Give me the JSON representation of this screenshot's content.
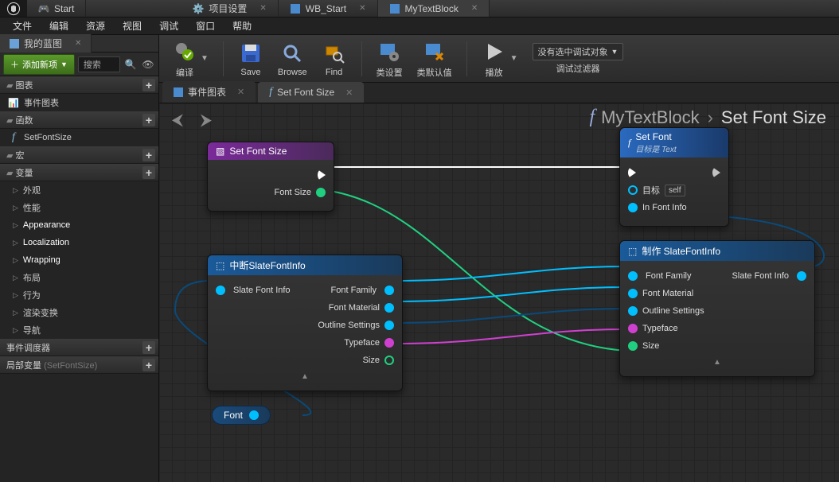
{
  "topTabs": [
    "Start",
    "项目设置",
    "WB_Start",
    "MyTextBlock"
  ],
  "menu": [
    "文件",
    "编辑",
    "资源",
    "视图",
    "调试",
    "窗口",
    "帮助"
  ],
  "bpTab": "我的蓝图",
  "addBtn": "添加新项",
  "searchPlaceholder": "搜索",
  "sections": {
    "charts": {
      "label": "图表",
      "items": [
        "事件图表"
      ]
    },
    "funcs": {
      "label": "函数",
      "items": [
        "SetFontSize"
      ]
    },
    "macros": {
      "label": "宏"
    },
    "vars": {
      "label": "变量",
      "items": [
        "外观",
        "性能",
        "Appearance",
        "Localization",
        "Wrapping",
        "布局",
        "行为",
        "渲染变换",
        "导航"
      ],
      "bold": [
        2,
        3,
        4
      ]
    },
    "disp": {
      "label": "事件调度器"
    },
    "local": {
      "label": "局部变量",
      "dim": "(SetFontSize)"
    }
  },
  "toolbar": {
    "compile": "编译",
    "save": "Save",
    "browse": "Browse",
    "find": "Find",
    "classSet": "类设置",
    "classDef": "类默认值",
    "play": "播放",
    "debugSel": "没有选中调试对象",
    "debugFilter": "调试过滤器"
  },
  "gtabs": [
    "事件图表",
    "Set Font Size"
  ],
  "bread": [
    "MyTextBlock",
    "Set Font Size"
  ],
  "nodes": {
    "entry": {
      "title": "Set Font Size",
      "pin": "Font Size"
    },
    "setFont": {
      "title": "Set Font",
      "sub": "目标是 Text",
      "target": "目标",
      "self": "self",
      "inFont": "In Font Info"
    },
    "break": {
      "title": "中断SlateFontInfo",
      "in": "Slate Font Info",
      "out": [
        "Font Family",
        "Font Material",
        "Outline Settings",
        "Typeface",
        "Size"
      ]
    },
    "make": {
      "title": "制作 SlateFontInfo",
      "out": "Slate Font Info",
      "in": [
        "Font Family",
        "Font Material",
        "Outline Settings",
        "Typeface",
        "Size"
      ]
    },
    "var": "Font"
  }
}
